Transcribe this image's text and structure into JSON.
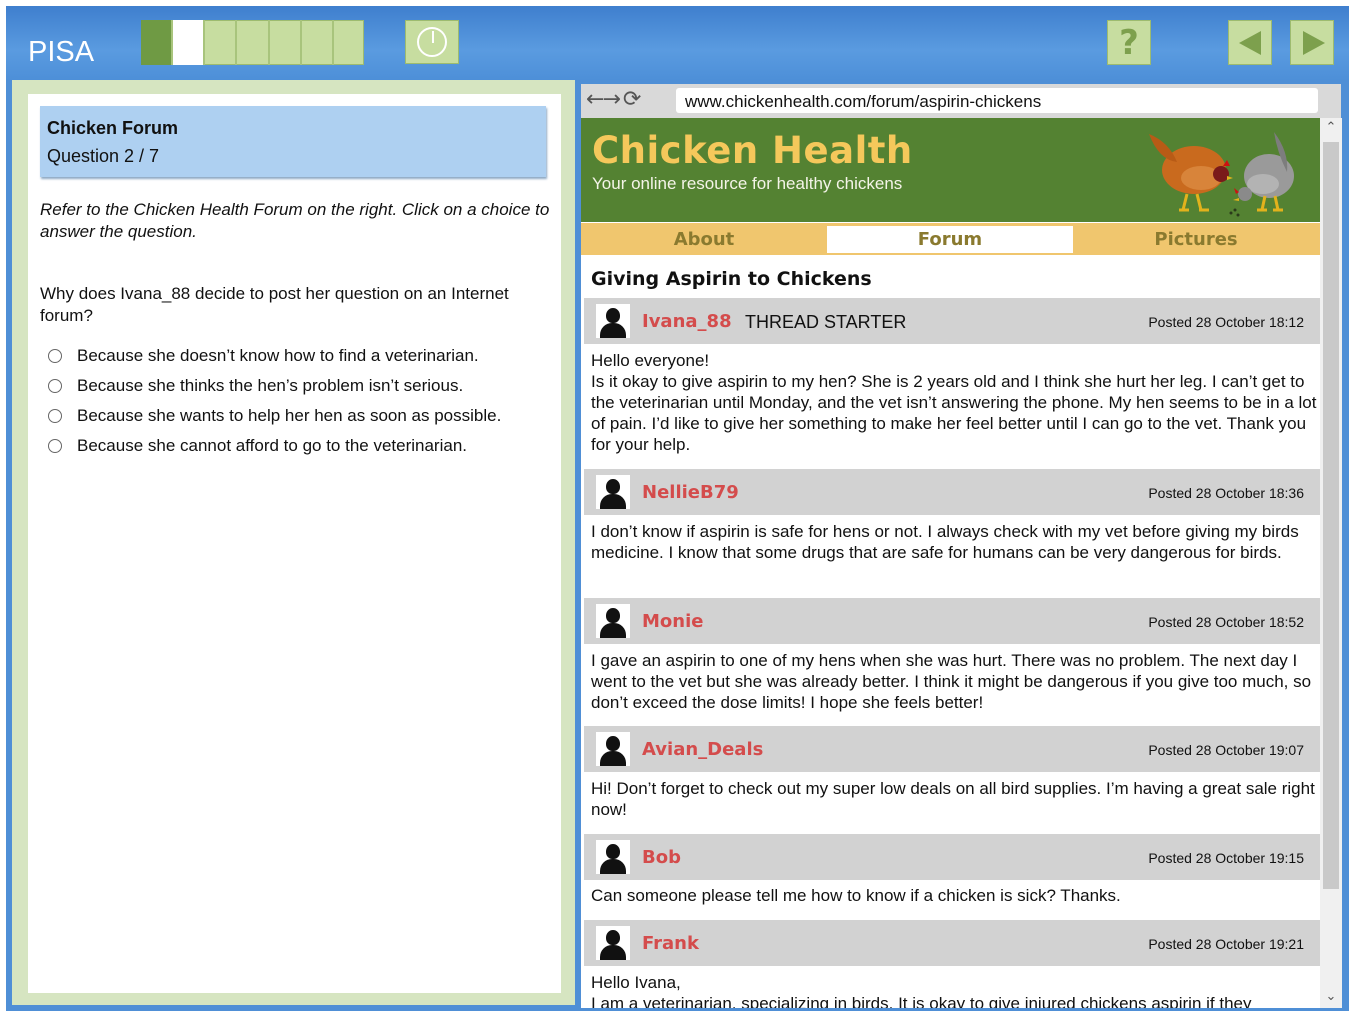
{
  "app": {
    "brand": "PISA",
    "progress": {
      "total": 7,
      "completed": 1,
      "current": 2
    },
    "icons": {
      "timer": "timer-icon",
      "help": "help-icon",
      "back": "back-arrow-icon",
      "next": "next-arrow-icon"
    },
    "help_label": "?"
  },
  "question_panel": {
    "title": "Chicken Forum",
    "number": "Question 2 / 7",
    "instructions": "Refer to the Chicken Health Forum on the right. Click on a choice to answer the question.",
    "question": "Why does Ivana_88 decide to post her question on an Internet forum?",
    "choices": [
      "Because she doesn’t know how to find a veterinarian.",
      "Because she thinks the hen’s problem isn’t serious.",
      "Because she wants to help her hen as soon as possible.",
      "Because she cannot afford to go to the veterinarian."
    ]
  },
  "browser": {
    "url": "www.chickenhealth.com/forum/aspirin-chickens",
    "site_title": "Chicken Health",
    "site_tagline": "Your online resource for healthy chickens",
    "nav": [
      "About",
      "Forum",
      "Pictures"
    ],
    "active_nav": "Forum",
    "thread_title": "Giving Aspirin to Chickens",
    "posts": [
      {
        "user": "Ivana_88",
        "badge": "THREAD STARTER",
        "posted": "Posted 28 October 18:12",
        "body": "Hello everyone!\nIs it okay to give aspirin to my hen? She is 2 years old and I think she hurt her leg. I can’t get to the veterinarian until Monday, and the vet isn’t answering the phone. My hen seems to be in a lot of pain. I’d like to give her something to make her feel better until I can go to the vet. Thank you for your help."
      },
      {
        "user": "NellieB79",
        "posted": "Posted 28 October 18:36",
        "body": "I don’t know if aspirin is safe for hens or not. I always check with my vet before giving my birds medicine. I know that some drugs that are safe for humans can be very dangerous for birds."
      },
      {
        "user": "Monie",
        "posted": "Posted 28 October 18:52",
        "body": "I gave an aspirin to one of my hens when she was hurt. There was no problem. The next day I went to the vet but she was already better. I think it might be dangerous if you give too much, so don’t exceed the dose limits! I hope she feels better!"
      },
      {
        "user": "Avian_Deals",
        "posted": "Posted 28 October 19:07",
        "body": "Hi! Don’t forget to check out my super low deals on all bird supplies. I’m having a great sale right now!"
      },
      {
        "user": "Bob",
        "posted": "Posted 28 October 19:15",
        "body": "Can someone please tell me how to know if a chicken is sick? Thanks."
      },
      {
        "user": "Frank",
        "posted": "Posted 28 October 19:21",
        "body": "Hello Ivana,\nI am a veterinarian, specializing in birds. It is okay to give injured chickens aspirin if they"
      }
    ]
  },
  "colors": {
    "header_blue": "#4f8fd6",
    "progress_done": "#6f9a44",
    "site_green": "#548232",
    "site_title": "#f5c85b",
    "nav_bar": "#f0c66e",
    "username": "#d44c4c"
  }
}
